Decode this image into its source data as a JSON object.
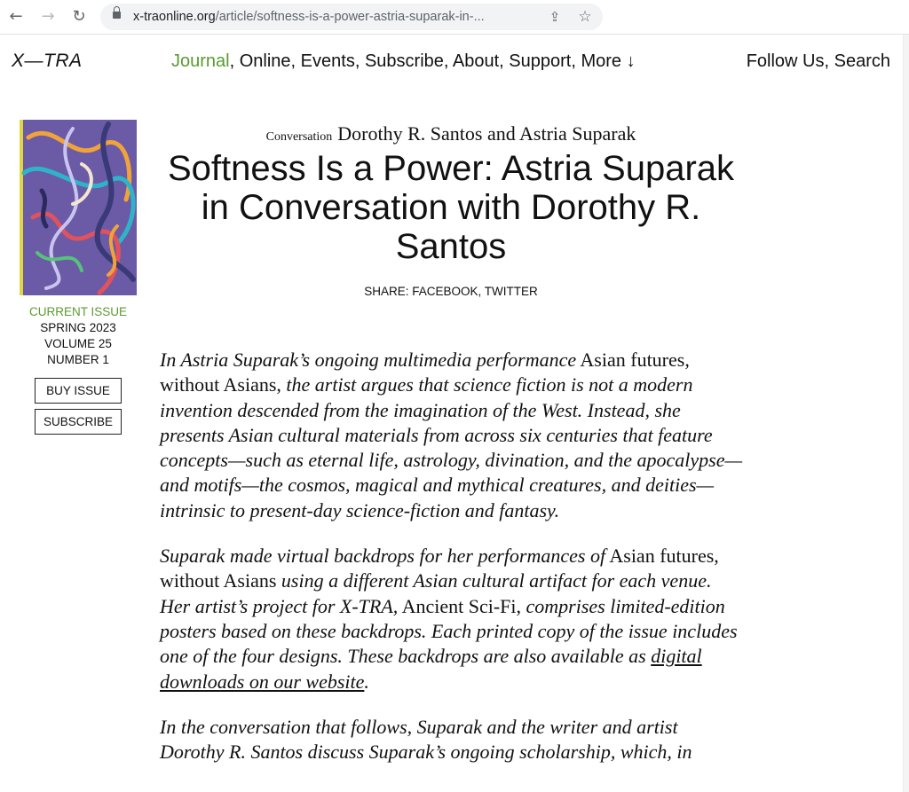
{
  "browser": {
    "url_domain": "x-traonline.org",
    "url_path": "/article/softness-is-a-power-astria-suparak-in-..."
  },
  "icons": {
    "back": "arrow-left-icon",
    "forward": "arrow-right-icon",
    "reload": "reload-icon",
    "lock": "lock-icon",
    "share": "share-icon",
    "star": "star-icon"
  },
  "colors": {
    "accent_green": "#5a9a2f",
    "text": "#111111"
  },
  "site": {
    "logo": "X—TRA",
    "nav": [
      {
        "label": "Journal",
        "active": true
      },
      {
        "label": "Online"
      },
      {
        "label": "Events"
      },
      {
        "label": "Subscribe"
      },
      {
        "label": "About"
      },
      {
        "label": "Support"
      },
      {
        "label": "More ↓"
      }
    ],
    "util_nav": [
      "Follow Us",
      "Search"
    ]
  },
  "sidebar": {
    "current_issue_label": "CURRENT ISSUE",
    "season": "SPRING 2023",
    "volume": "VOLUME 25",
    "number": "NUMBER 1",
    "buy_label": "BUY ISSUE",
    "subscribe_label": "SUBSCRIBE"
  },
  "article": {
    "category": "Conversation",
    "authors": "Dorothy R. Santos and Astria Suparak",
    "title": "Softness Is a Power: Astria Suparak in Conversation with Dorothy R. Santos",
    "share_label": "SHARE:",
    "share_facebook": "FACEBOOK",
    "share_twitter": "TWITTER",
    "p1_a": "In Astria Suparak’s ongoing multimedia performance",
    "p1_b": "Asian futures, without Asians,",
    "p1_c": "the artist argues that science fiction is not a modern invention descended from the imagination of the West. Instead, she presents Asian cultural materials from across six centuries that feature concepts—such as eternal life, astrology, divination, and the apocalypse—and motifs—the cosmos, magical and mythical creatures, and deities—intrinsic to present-day science-fiction and fantasy.",
    "p2_a": "Suparak made virtual backdrops for her performances of",
    "p2_b": "Asian futures, without Asians",
    "p2_c": "using a different Asian cultural artifact for each venue. Her artist’s project for X-TRA,",
    "p2_d": "Ancient Sci-Fi,",
    "p2_e": "comprises limited-edition posters based on these backdrops. Each printed copy of the issue includes one of the four designs. These backdrops are also available as",
    "p2_link": "digital downloads on our website",
    "p2_f": ".",
    "p3": "In the conversation that follows, Suparak and the writer and artist Dorothy R. Santos discuss Suparak’s ongoing scholarship, which, in"
  }
}
